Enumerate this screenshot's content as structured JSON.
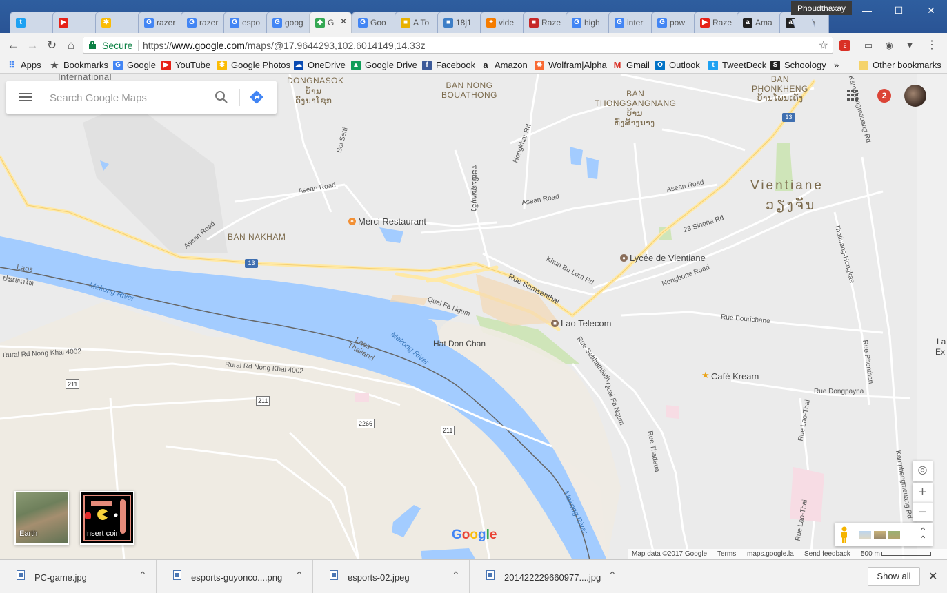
{
  "window": {
    "profile_name": "Phoudthaxay",
    "minimize": "—",
    "maximize": "☐",
    "close": "✕"
  },
  "tabs": [
    {
      "label": "",
      "icon": "twitter-icon",
      "color": "#1da1f2"
    },
    {
      "label": "",
      "icon": "youtube-icon",
      "color": "#e62117"
    },
    {
      "label": "",
      "icon": "google-photos-icon",
      "color": "#fbbc05"
    },
    {
      "label": "razer",
      "icon": "google-icon",
      "color": "#4285f4"
    },
    {
      "label": "razer",
      "icon": "google-icon",
      "color": "#4285f4"
    },
    {
      "label": "espo",
      "icon": "google-icon",
      "color": "#4285f4"
    },
    {
      "label": "goog",
      "icon": "google-icon",
      "color": "#4285f4"
    },
    {
      "label": "G",
      "icon": "google-maps-icon",
      "color": "#34a853",
      "active": true
    },
    {
      "label": "Goo",
      "icon": "google-icon",
      "color": "#4285f4"
    },
    {
      "label": "A To",
      "icon": "site-icon",
      "color": "#e8b100"
    },
    {
      "label": "18j1",
      "icon": "site-icon",
      "color": "#3d7ec7"
    },
    {
      "label": "vide",
      "icon": "plus-site-icon",
      "color": "#f57c00"
    },
    {
      "label": "Raze",
      "icon": "site-icon",
      "color": "#c62828"
    },
    {
      "label": "high",
      "icon": "google-icon",
      "color": "#4285f4"
    },
    {
      "label": "inter",
      "icon": "google-icon",
      "color": "#4285f4"
    },
    {
      "label": "pow",
      "icon": "google-icon",
      "color": "#4285f4"
    },
    {
      "label": "Raze",
      "icon": "youtube-icon",
      "color": "#e62117"
    },
    {
      "label": "Ama",
      "icon": "amazon-icon",
      "color": "#222222"
    },
    {
      "label": "Ama",
      "icon": "amazon-icon",
      "color": "#222222"
    }
  ],
  "toolbar": {
    "secure_label": "Secure",
    "url_prefix": "https://",
    "url_host": "www.google.com",
    "url_path": "/maps/@17.9644293,102.6014149,14.33z",
    "ext_badge": "2"
  },
  "bookmarks": [
    {
      "label": "Apps",
      "icon": "apps-grid-icon",
      "color": "#4285f4"
    },
    {
      "label": "Bookmarks",
      "icon": "star-icon",
      "color": "#555555"
    },
    {
      "label": "Google",
      "icon": "google-icon",
      "color": "#4285f4"
    },
    {
      "label": "YouTube",
      "icon": "youtube-icon",
      "color": "#e62117"
    },
    {
      "label": "Google Photos",
      "icon": "google-photos-icon",
      "color": "#fbbc05"
    },
    {
      "label": "OneDrive",
      "icon": "cloud-icon",
      "color": "#094ab2"
    },
    {
      "label": "Google Drive",
      "icon": "drive-icon",
      "color": "#0f9d58"
    },
    {
      "label": "Facebook",
      "icon": "facebook-icon",
      "color": "#3b5998"
    },
    {
      "label": "Amazon",
      "icon": "amazon-icon",
      "color": "#222222"
    },
    {
      "label": "Wolfram|Alpha",
      "icon": "wolfram-icon",
      "color": "#f96932"
    },
    {
      "label": "Gmail",
      "icon": "gmail-icon",
      "color": "#d93025"
    },
    {
      "label": "Outlook",
      "icon": "outlook-icon",
      "color": "#0072c6"
    },
    {
      "label": "TweetDeck",
      "icon": "tweetdeck-icon",
      "color": "#1da1f2"
    },
    {
      "label": "Schoology",
      "icon": "schoology-icon",
      "color": "#222222"
    }
  ],
  "bookmarks_overflow": "»",
  "other_bookmarks": "Other bookmarks",
  "maps": {
    "search_placeholder": "Search Google Maps",
    "notifications": "2",
    "layers": {
      "earth": "Earth",
      "pacman": "Insert coin"
    },
    "zoom_in": "+",
    "zoom_out": "−",
    "google_logo": [
      "G",
      "o",
      "o",
      "g",
      "l",
      "e"
    ],
    "logo_colors": [
      "#4285f4",
      "#ea4335",
      "#fbbc05",
      "#4285f4",
      "#34a853",
      "#ea4335"
    ],
    "attribution": {
      "data": "Map data ©2017 Google",
      "terms": "Terms",
      "domain": "maps.google.la",
      "feedback": "Send feedback",
      "scale": "500 m"
    },
    "labels": {
      "international": "International",
      "dongnasok": "DONGNASOK",
      "dongnasok_lao": "ບ້ານ\nດົງນາໂຊກ",
      "ban_nong_bouathong": "BAN NONG\nBOUATHONG",
      "ban_thongsangnang": "BAN\nTHONGSANGNANG",
      "thongsangnang_lao": "ບ້ານ\nທົ່ງສ້າງນາງ",
      "ban_phonkheng": "BAN\nPHONKHENG",
      "phonkheng_lao": "ບ້ານໂພນເຄັງ",
      "vientiane": "Vientiane",
      "vientiane_lao": "ວຽງຈັນ",
      "ban_nakham": "BAN NAKHAM",
      "hat_don_chan": "Hat Don Chan",
      "laos_left": "Laos",
      "thailand_left": "ປະເທດໄທ",
      "laos_mid": "Laos",
      "thailand_mid": "Thailand",
      "la_ex_1": "La",
      "la_ex_2": "Ex"
    },
    "roads": {
      "soi_setti": "Soi Setti",
      "asean_road_1": "Asean Road",
      "asean_road_2": "Asean Road",
      "asean_road_3": "Asean Road",
      "asean_road_4": "Asean Road",
      "hongkhar": "Hongkhar Rd",
      "lao_vertical": "ຖະໜົນສຸພານຸວົງ",
      "kamphengmeuang_top": "Kamphengmeuang Rd",
      "singha": "23 Singha Rd",
      "khun_bu_lom": "Khun Bu Lom Rd",
      "samsenthai": "Rue Samsenthai",
      "quai_fa_ngum": "Quai Fa Ngum",
      "nongbone": "Nongbone Road",
      "thatluang_hongkae": "Thatluang-Hongkae",
      "bourichane": "Rue Bourichane",
      "setthathilath": "Rue Setthathilath",
      "phonthan": "Rue Phonthan",
      "dongpayna": "Rue Dongpayna",
      "lao_thai_1": "Rue Lao-Thai",
      "lao_thai_2": "Rue Lao-Thai",
      "quai_fa_ngum_2": "Quai Fa Ngum",
      "thadeua": "Rue Thadeua",
      "kamphengmeuang_bottom": "Kamphengmeuang Rd",
      "rural_4002_a": "Rural Rd Nong Khai 4002",
      "rural_4002_b": "Rural Rd Nong Khai 4002"
    },
    "rivers": {
      "mekong_1": "Mekong River",
      "mekong_2": "Mekong River",
      "mekong_3": "Mekong River"
    },
    "pois": {
      "merci": "Merci Restaurant",
      "lycee": "Lycée de Vientiane",
      "lao_telecom": "Lao Telecom",
      "cafe_kream": "Café Kream"
    },
    "shields": {
      "r13_a": "13",
      "r13_b": "13",
      "r211_a": "211",
      "r211_b": "211",
      "r211_c": "211",
      "r2266": "2266"
    }
  },
  "downloads": [
    {
      "name": "PC-game.jpg"
    },
    {
      "name": "esports-guyonco....png"
    },
    {
      "name": "esports-02.jpeg"
    },
    {
      "name": "201422229660977....jpg"
    }
  ],
  "show_all": "Show all",
  "shelf_close": "✕"
}
